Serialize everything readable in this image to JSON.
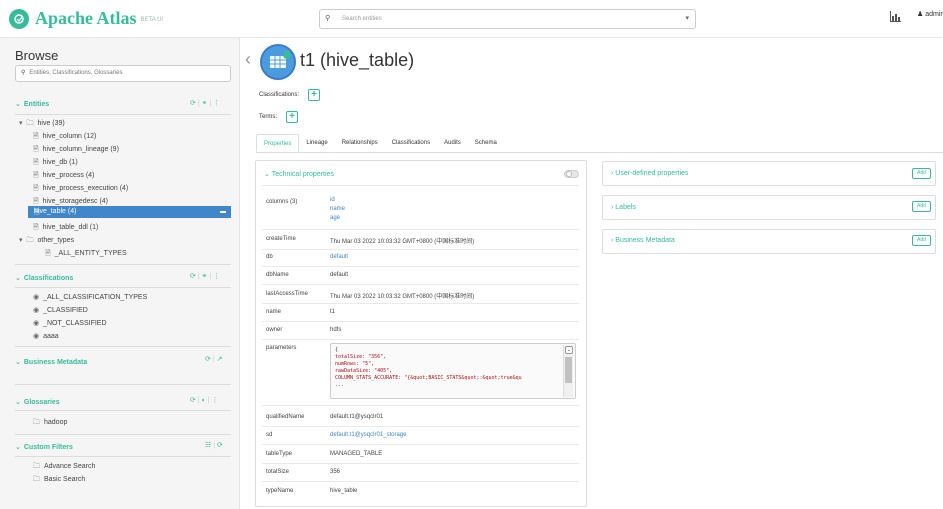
{
  "app": {
    "name": "Apache Atlas",
    "beta": "BETA UI",
    "user": "admin"
  },
  "search": {
    "placeholder": "Search entities"
  },
  "sidebar": {
    "title": "Browse",
    "search_placeholder": "Entities, Classifications, Glossaries",
    "entities": {
      "label": "Entities",
      "tree": [
        {
          "label": "hive (39)",
          "level": 0,
          "type": "folder"
        },
        {
          "label": "hive_column (12)",
          "level": 1,
          "type": "file"
        },
        {
          "label": "hive_column_lineage (9)",
          "level": 1,
          "type": "file"
        },
        {
          "label": "hive_db (1)",
          "level": 1,
          "type": "file"
        },
        {
          "label": "hive_process (4)",
          "level": 1,
          "type": "file"
        },
        {
          "label": "hive_process_execution (4)",
          "level": 1,
          "type": "file"
        },
        {
          "label": "hive_storagedesc (4)",
          "level": 1,
          "type": "file"
        },
        {
          "label": "hive_table (4)",
          "level": 1,
          "type": "file",
          "selected": true
        },
        {
          "label": "hive_table_ddl (1)",
          "level": 1,
          "type": "file"
        },
        {
          "label": "other_types",
          "level": 0,
          "type": "folder"
        },
        {
          "label": "_ALL_ENTITY_TYPES",
          "level": 1,
          "type": "file"
        }
      ]
    },
    "classifications": {
      "label": "Classifications",
      "items": [
        "_ALL_CLASSIFICATION_TYPES",
        "_CLASSIFIED",
        "_NOT_CLASSIFIED",
        "aaaa"
      ]
    },
    "business_metadata": {
      "label": "Business Metadata"
    },
    "glossaries": {
      "label": "Glossaries",
      "items": [
        "hadoop"
      ]
    },
    "custom_filters": {
      "label": "Custom Filters",
      "items": [
        "Advance Search",
        "Basic Search"
      ]
    }
  },
  "entity": {
    "name": "t1",
    "type": "(hive_table)",
    "classifications_label": "Classifications:",
    "terms_label": "Terms:"
  },
  "tabs": [
    "Properties",
    "Lineage",
    "Relationships",
    "Classifications",
    "Audits",
    "Schema"
  ],
  "technical": {
    "title": "Technical properties",
    "rows": {
      "columns_key": "columns (3)",
      "columns": [
        "id",
        "name",
        "age"
      ],
      "createTime_key": "createTime",
      "createTime": "Thu Mar 03 2022 10:03:32 GMT+0800 (中国标准时间)",
      "db_key": "db",
      "db": "default",
      "dbName_key": "dbName",
      "dbName": "default",
      "lastAccessTime_key": "lastAccessTime",
      "lastAccessTime": "Thu Mar 03 2022 10:03:32 GMT+0800 (中国标准时间)",
      "name_key": "name",
      "name": "t1",
      "owner_key": "owner",
      "owner": "hdfs",
      "parameters_key": "parameters",
      "parameters_lines": [
        "{",
        "  totalSize: \"356\",",
        "  numRows: \"5\",",
        "  rawDataSize: \"405\",",
        "  COLUMN_STATS_ACCURATE: \"{&quot;BASIC_STATS&quot;:&quot;true&qu",
        "  ..."
      ],
      "qualifiedName_key": "qualifiedName",
      "qualifiedName": "default.t1@ysqclr01",
      "sd_key": "sd",
      "sd": "default.t1@ysqclr01_storage",
      "tableType_key": "tableType",
      "tableType": "MANAGED_TABLE",
      "totalSize_key": "totalSize",
      "totalSize": "356",
      "typeName_key": "typeName",
      "typeName": "hive_table"
    }
  },
  "right_panels": [
    {
      "label": "User-defined properties",
      "button": "Add"
    },
    {
      "label": "Labels",
      "button": "Add"
    },
    {
      "label": "Business Metadata",
      "button": "Add"
    }
  ],
  "colors": {
    "accent": "#37bb9b",
    "selected": "#3f87c8",
    "link": "#3f87c8"
  }
}
